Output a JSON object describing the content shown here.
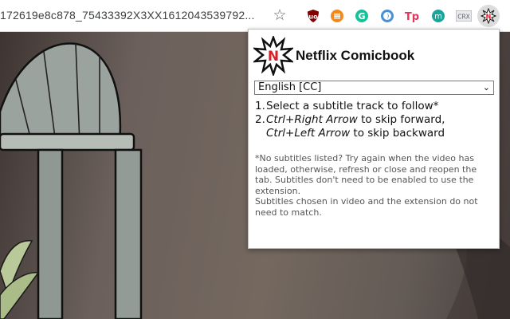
{
  "browser": {
    "url": "172619e8c878_75433392X3XX1612043539792...",
    "extensions": [
      {
        "name": "ublock-origin-icon",
        "glyph": "ᵘ",
        "color": "#800000"
      },
      {
        "name": "orange-gear-extension-icon",
        "glyph": "≡",
        "color": "#f18a1e"
      },
      {
        "name": "grammarly-icon",
        "glyph": "G",
        "color": "#15c39a"
      },
      {
        "name": "blue-circle-extension-icon",
        "glyph": "ƒ",
        "color": "#4a90d9"
      },
      {
        "name": "tp-extension-icon",
        "glyph": "Tp",
        "color": "#e8335a"
      },
      {
        "name": "mendeley-icon",
        "glyph": "m",
        "color": "#1aa59a"
      },
      {
        "name": "crx-extension-icon",
        "glyph": "CRX",
        "color": "#5f6368"
      },
      {
        "name": "netflix-comicbook-extension-icon",
        "glyph": "N",
        "color": "#d81f26"
      }
    ]
  },
  "popup": {
    "title": "Netflix Comicbook",
    "subtitle_select": {
      "selected": "English [CC]"
    },
    "steps": {
      "step1_number": "1.",
      "step1_text": "Select a subtitle track to follow*",
      "step2_number": "2.",
      "step2_key1": "Ctrl+Right Arrow",
      "step2_text1": " to skip forward,",
      "step2_key2": "Ctrl+Left Arrow",
      "step2_text2": " to skip backward"
    },
    "note": {
      "line1": "*No subtitles listed? Try again when the video has loaded, otherwise, refresh or close and reopen the tab. Subtitles don't need to be enabled to use the extension.",
      "line2": "Subtitles chosen in video and the extension do not need to match."
    }
  }
}
